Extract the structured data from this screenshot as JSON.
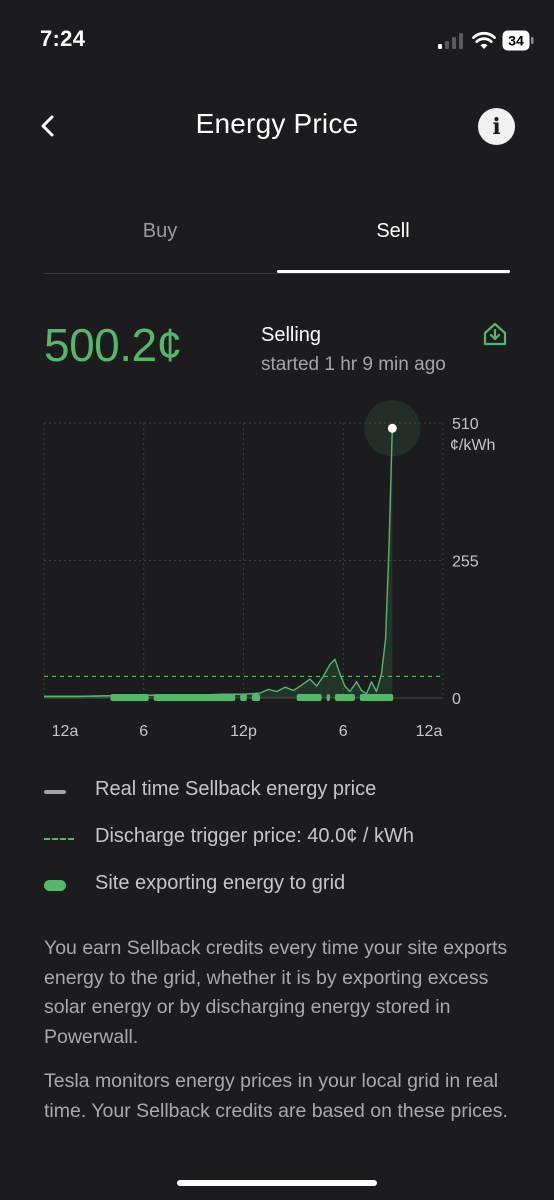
{
  "status_bar": {
    "time": "7:24",
    "battery": "34"
  },
  "header": {
    "title": "Energy Price"
  },
  "tabs": [
    {
      "label": "Buy",
      "selected": false
    },
    {
      "label": "Sell",
      "selected": true
    }
  ],
  "summary": {
    "price": "500.2¢",
    "status_title": "Selling",
    "status_subtitle": "started 1 hr 9 min ago"
  },
  "colors": {
    "accent": "#56b66c",
    "background": "#1c1c1e",
    "muted": "#a5a5a7"
  },
  "icons": {
    "back": "chevron-left-icon",
    "info": "info-icon",
    "export": "home-export-icon"
  },
  "chart_data": {
    "type": "line",
    "y_unit": "¢/kWh",
    "ylim": [
      0,
      510
    ],
    "yticks": [
      "510",
      "255",
      "0"
    ],
    "xticks": [
      "12a",
      "6",
      "12p",
      "6",
      "12a"
    ],
    "x_range_hours": [
      0,
      24
    ],
    "grid": true,
    "series": [
      {
        "name": "Real time Sellback energy price",
        "points": [
          [
            0,
            3
          ],
          [
            2,
            3
          ],
          [
            4,
            4
          ],
          [
            6,
            5
          ],
          [
            8,
            6
          ],
          [
            10,
            6
          ],
          [
            11,
            7
          ],
          [
            12,
            7
          ],
          [
            13,
            9
          ],
          [
            13.5,
            16
          ],
          [
            14,
            12
          ],
          [
            14.5,
            20
          ],
          [
            15,
            14
          ],
          [
            15.5,
            24
          ],
          [
            16,
            35
          ],
          [
            16.4,
            22
          ],
          [
            16.8,
            40
          ],
          [
            17.2,
            62
          ],
          [
            17.5,
            72
          ],
          [
            17.8,
            45
          ],
          [
            18.1,
            22
          ],
          [
            18.4,
            12
          ],
          [
            18.8,
            30
          ],
          [
            19.1,
            14
          ],
          [
            19.4,
            8
          ],
          [
            19.7,
            30
          ],
          [
            20.0,
            12
          ],
          [
            20.3,
            45
          ],
          [
            20.55,
            110
          ],
          [
            20.75,
            280
          ],
          [
            20.95,
            500.2
          ]
        ]
      }
    ],
    "discharge_trigger": 40.0,
    "current_value": 500.2,
    "export_intervals": [
      [
        4,
        6.3
      ],
      [
        6.6,
        11.5
      ],
      [
        11.8,
        12.2
      ],
      [
        12.5,
        13.0
      ],
      [
        15.2,
        16.7
      ],
      [
        17.0,
        17.2
      ],
      [
        17.5,
        18.7
      ],
      [
        19.0,
        21.0
      ]
    ],
    "legend": [
      {
        "label": "Real time Sellback energy price",
        "style": "solid-gray"
      },
      {
        "label": "Discharge trigger price: 40.0¢ / kWh",
        "style": "dashed-green"
      },
      {
        "label": "Site exporting energy to grid",
        "style": "solid-green-pill"
      }
    ]
  },
  "description": {
    "paragraph1": "You earn Sellback credits every time your site exports energy to the grid, whether it is by exporting excess solar energy or by discharging energy stored in Powerwall.",
    "paragraph2": "Tesla monitors energy prices in your local grid in real time. Your Sellback credits are based on these prices."
  }
}
